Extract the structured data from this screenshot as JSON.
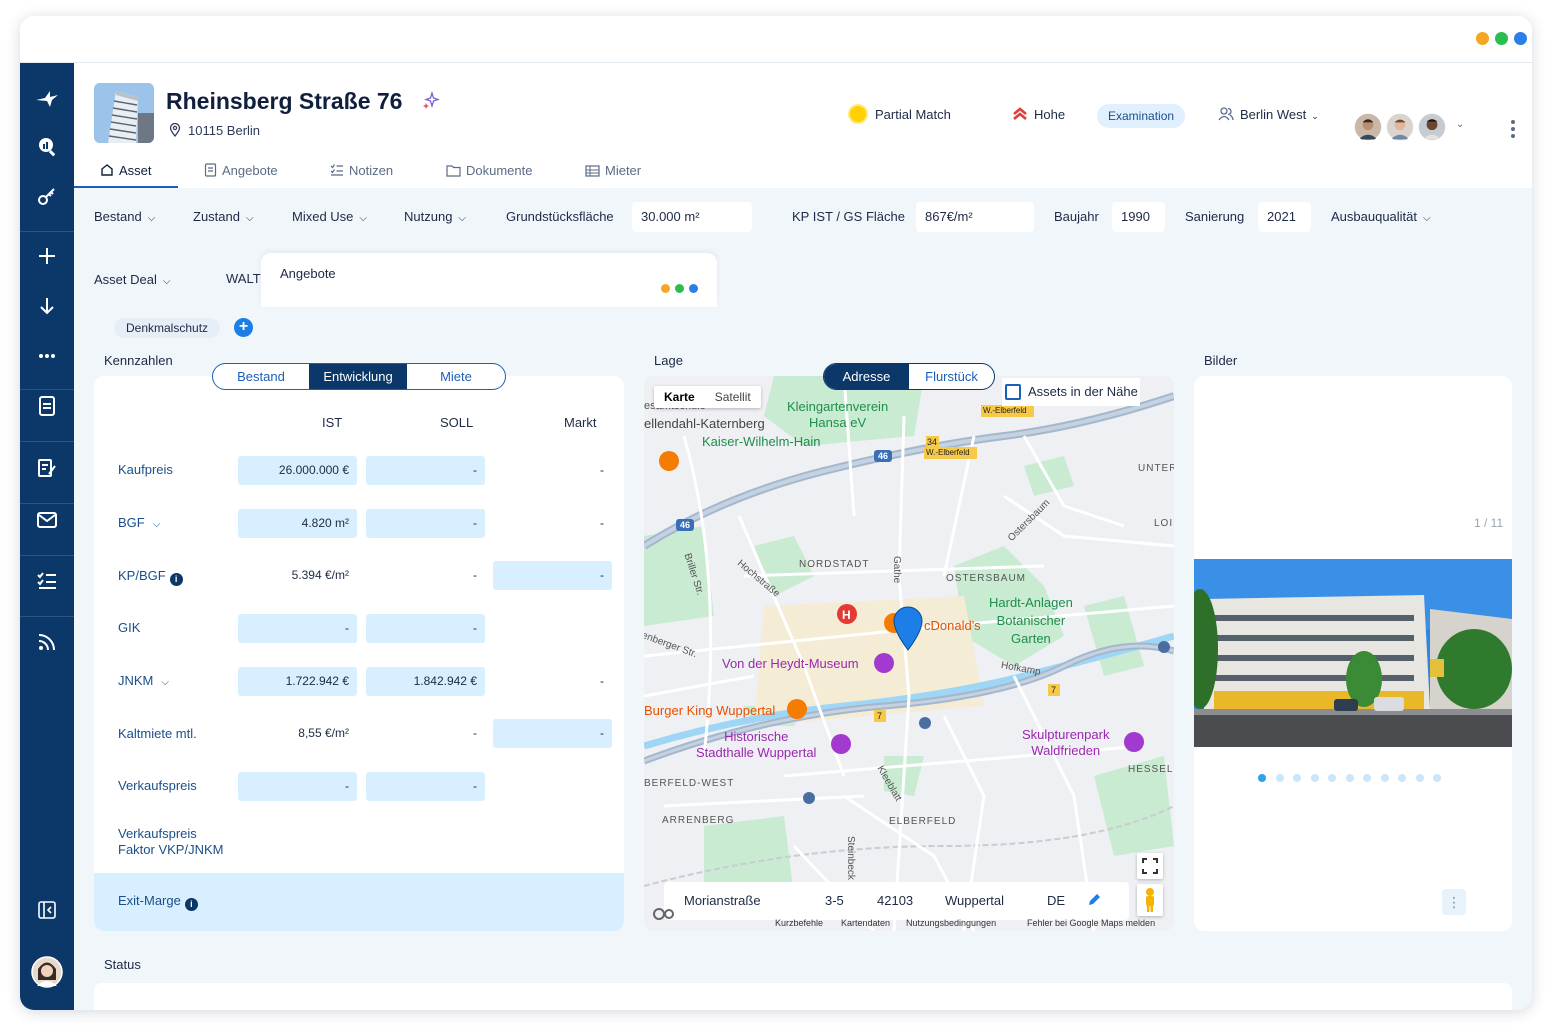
{
  "window": {
    "dot_colors": [
      "#f5a623",
      "#2bbd4e",
      "#2b7de9"
    ]
  },
  "sidebar": {
    "items": [
      "logo-bird-icon",
      "search-chart-icon",
      "key-icon",
      "plus-icon",
      "download-icon",
      "more-icon",
      "document-icon",
      "form-icon",
      "mail-icon",
      "checklist-icon",
      "feed-icon",
      "collapse-sidebar-icon",
      "user-avatar"
    ]
  },
  "header": {
    "title": "Rheinsberg Straße 76",
    "location": "10115 Berlin",
    "match_label": "Partial Match",
    "priority_label": "Hohe",
    "stage_badge": "Examination",
    "team_label": "Berlin West"
  },
  "tabs": [
    {
      "label": "Asset",
      "icon": "home-icon",
      "active": true
    },
    {
      "label": "Angebote",
      "icon": "document-icon",
      "active": false
    },
    {
      "label": "Notizen",
      "icon": "checklist-icon",
      "active": false
    },
    {
      "label": "Dokumente",
      "icon": "folder-icon",
      "active": false
    },
    {
      "label": "Mieter",
      "icon": "building-icon",
      "active": false
    }
  ],
  "filters": {
    "bestand": "Bestand",
    "zustand": "Zustand",
    "mixed_use": "Mixed Use",
    "nutzung": "Nutzung",
    "grundstuecksflaeche_label": "Grundstücksfläche",
    "grundstuecksflaeche_value": "30.000 m²",
    "kp_ist_label": "KP IST / GS Fläche",
    "kp_ist_value": "867€/m²",
    "baujahr_label": "Baujahr",
    "baujahr_value": "1990",
    "sanierung_label": "Sanierung",
    "sanierung_value": "2021",
    "ausbauqualitaet": "Ausbauqualität",
    "asset_deal": "Asset Deal",
    "walt": "WALT"
  },
  "popup": {
    "title": "Angebote"
  },
  "tags": {
    "denkmalschutz": "Denkmalschutz",
    "add": "+"
  },
  "kennzahlen": {
    "title": "Kennzahlen",
    "segments": [
      "Bestand",
      "Entwicklung",
      "Miete"
    ],
    "active_segment": "Entwicklung",
    "columns": [
      "IST",
      "SOLL",
      "Markt"
    ],
    "rows": [
      {
        "label": "Kaufpreis",
        "ist": "26.000.000 €",
        "soll": "-",
        "markt": "-"
      },
      {
        "label": "BGF",
        "ist": "4.820 m²",
        "soll": "-",
        "markt": "-"
      },
      {
        "label": "KP/BGF",
        "ist": "5.394 €/m²",
        "soll": "-",
        "markt": "-"
      },
      {
        "label": "GIK",
        "ist": "-",
        "soll": "-",
        "markt": ""
      },
      {
        "label": "JNKM",
        "ist": "1.722.942 €",
        "soll": "1.842.942 €",
        "markt": "-"
      },
      {
        "label": "Kaltmiete mtl.",
        "ist": "8,55 €/m²",
        "soll": "-",
        "markt": "-"
      },
      {
        "label": "Verkaufspreis",
        "ist": "-",
        "soll": "-",
        "markt": ""
      },
      {
        "label": "Verkaufspreis\nFaktor VKP/JNKM",
        "ist": "",
        "soll": "",
        "markt": ""
      }
    ],
    "exit_label": "Exit-Marge"
  },
  "lage": {
    "title": "Lage",
    "segments": [
      "Adresse",
      "Flurstück"
    ],
    "active_segment": "Adresse",
    "map_types": [
      "Karte",
      "Satellit"
    ],
    "nearby_label": "Assets in der Nähe",
    "map_labels": {
      "kleingarten": "Kleingartenverein\nHansa eV",
      "kaiser": "Kaiser-Wilhelm-Hain",
      "katernberg": "ellendahl-Katernberg",
      "schule": "esamtschule",
      "nordstadt": "NORDSTADT",
      "ostersbaum": "OSTERSBAUM",
      "hardt": "Hardt-Anlagen\nBotanischer\nGarten",
      "mcdonalds": "cDonald's",
      "heydt": "Von der Heydt-Museum",
      "burger": "Burger King Wuppertal",
      "stadthalle": "Historische\nStadthalle Wuppertal",
      "skulpturen": "Skulpturenpark\nWaldfrieden",
      "elberfeld_west": "BERFELD-WEST",
      "arrenberg": "ARRENBERG",
      "elberfeld": "ELBERFELD",
      "hesseln": "HESSELN",
      "unter": "UNTER",
      "lo": "LOI",
      "road_46a": "46",
      "road_46b": "46",
      "road_34": "34",
      "road_7a": "7",
      "road_7b": "7",
      "welberfeld1": "W.-Elberfeld",
      "welberfeld2": "W.-Elberfeld",
      "briller": "Briller Str.",
      "hochstrasse": "Hochstraße",
      "gathe": "Gathe",
      "hofkamp": "Hofkamp",
      "kleeblatt": "Kleeblatt",
      "ostersbaum_str": "Ostersbaum",
      "steinbeck": "Steinbeck",
      "berger": "enberger Str."
    },
    "address": {
      "street": "Morianstraße",
      "number": "3-5",
      "zip": "42103",
      "city": "Wuppertal",
      "country": "DE"
    },
    "footer": [
      "Kurzbefehle",
      "Kartendaten",
      "Nutzungsbedingungen",
      "Fehler bei Google Maps melden"
    ]
  },
  "bilder": {
    "title": "Bilder",
    "counter": "1 / 11",
    "page_count": 11,
    "active_page": 1
  },
  "status": {
    "title": "Status"
  }
}
